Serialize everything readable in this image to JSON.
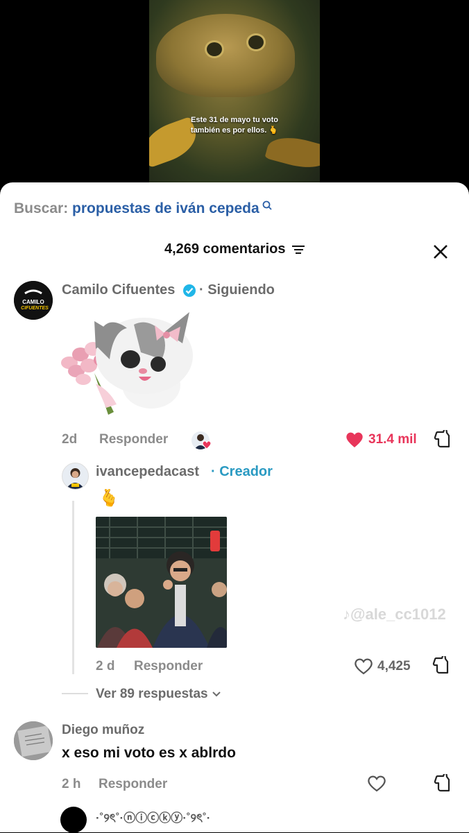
{
  "video": {
    "caption_line1": "Este 31 de mayo tu voto",
    "caption_line2": "también es por ellos. 🫰"
  },
  "search": {
    "label": "Buscar:",
    "query": "propuestas de iván cepeda",
    "icon": "search-icon"
  },
  "comments_header": {
    "count_label": "4,269 comentarios",
    "filter_icon": "filter-icon",
    "close_icon": "close-icon"
  },
  "comments": [
    {
      "author": "Camilo Cifuentes",
      "verified": true,
      "follow_status": "· Siguiendo",
      "avatar_text": "CAMILO CIFUENTES",
      "age": "2d",
      "reply_label": "Responder",
      "likes": "31.4 mil",
      "liked": true,
      "replies": [
        {
          "author": "ivancepedacast",
          "role": "· Creador",
          "emoji": "🫰",
          "age": "2 d",
          "reply_label": "Responder",
          "likes": "4,425"
        }
      ],
      "view_replies": "Ver 89 respuestas"
    },
    {
      "author": "Diego muñoz",
      "text": "x eso mi voto es x ablrdo",
      "age": "2 h",
      "reply_label": "Responder"
    },
    {
      "author": "·˚୨ৎ˚·ⓝⓘⓒⓚⓨ·˚୨ৎ˚·"
    }
  ],
  "watermark": "@ale_cc1012",
  "colors": {
    "accent_blue": "#2b5fa6",
    "creator": "#2a9ac2",
    "like_red": "#e8355a",
    "verified": "#20b6e8"
  }
}
